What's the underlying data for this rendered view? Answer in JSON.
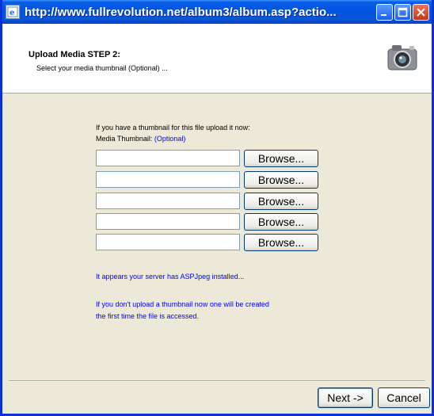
{
  "window": {
    "title": "http://www.fullrevolution.net/album3/album.asp?actio..."
  },
  "header": {
    "step_title": "Upload Media STEP 2:",
    "step_subtitle": "Select your media thumbnail (Optional) ..."
  },
  "form": {
    "intro_line": "If you have a thumbnail for this file upload it now:",
    "field_label": "Media Thumbnail:",
    "field_optional": "(Optional)",
    "file_inputs": [
      {
        "value": "",
        "button_label": "Browse..."
      },
      {
        "value": "",
        "button_label": "Browse..."
      },
      {
        "value": "",
        "button_label": "Browse..."
      },
      {
        "value": "",
        "button_label": "Browse..."
      },
      {
        "value": "",
        "button_label": "Browse..."
      }
    ],
    "aspjpeg_notice": "It appears your server has ASPJpeg installed...",
    "thumbnail_notice_line1": "If you don't upload a thumbnail now one will be created",
    "thumbnail_notice_line2": "the first time the file is accessed."
  },
  "footer": {
    "next_label": "Next ->",
    "cancel_label": "Cancel"
  },
  "colors": {
    "titlebar": "#0054e3",
    "dialog_bg": "#ece9d8",
    "link_text": "#0000ff"
  },
  "icons": {
    "title": "ie-page-icon",
    "header": "camera-icon",
    "minimize": "minimize-icon",
    "maximize": "maximize-icon",
    "close": "close-icon"
  }
}
